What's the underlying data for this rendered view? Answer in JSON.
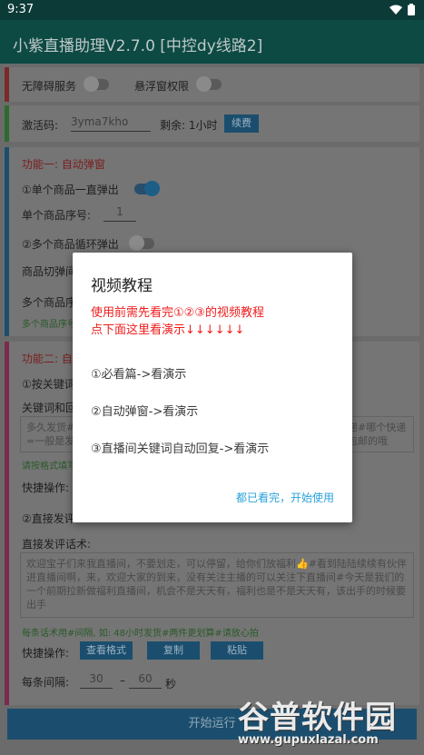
{
  "status": {
    "time": "9:37"
  },
  "app": {
    "title": "小紫直播助理V2.7.0 [中控dy线路2]"
  },
  "permissions": {
    "accessibility": "无障碍服务",
    "overlay": "悬浮窗权限"
  },
  "activation": {
    "label": "激活码:",
    "code": "3yma7kho",
    "remaining": "剩余: 1小时",
    "renew": "续费"
  },
  "func1": {
    "title": "功能一: 自动弹窗",
    "single_popup": "①单个商品一直弹出",
    "single_index_label": "单个商品序号:",
    "single_index_value": "1",
    "multi_loop": "②多个商品循环弹出",
    "switch_label": "商品切弹间",
    "multi_index_label": "多个商品序",
    "hint": "多个商品序号"
  },
  "func2": {
    "title": "功能二: 自",
    "keyword_reply": "①按关键词",
    "keyword_label": "关键词和回",
    "keyword_text": "多久发货#\n=一般是发",
    "keyword_text_right": "递#哪个快递\n包邮的哦",
    "format_hint": "请按格式填写",
    "quick_ops": "快捷操作:",
    "direct_comment": "②直接发评",
    "direct_label": "直接发评话术:",
    "direct_text": "欢迎宝子们来我直播间，不要划走，可以停留，给你们放福利👍#看到陆陆续续有伙伴进直播间啊，来，欢迎大家的到来，没有关注主播的可以关注下直播间#今天是我们的一个前期拉新做福利直播间，机会不是天天有，福利也是不是天天有，该出手的时候要出手",
    "per_hint": "每条话术用#间隔, 如: 48小时发货#两件更划算#请放心拍",
    "quick_ops2": "快捷操作:",
    "btn_format": "查看格式",
    "btn_copy": "复制",
    "btn_paste": "粘贴",
    "interval_label": "每条间隔:",
    "interval_min": "30",
    "interval_dash": "–",
    "interval_max": "60",
    "interval_unit": "秒"
  },
  "start_button": "开始运行",
  "dialog": {
    "title": "视频教程",
    "warning_line1": "使用前需先看完①②③的视频教程",
    "warning_line2": "点下面这里看演示↓↓↓↓↓↓",
    "item1": "①必看篇->看演示",
    "item2": "②自动弹窗->看演示",
    "item3": "③直播间关键词自动回复->看演示",
    "confirm": "都已看完，开始使用"
  },
  "watermark": {
    "name": "谷普软件园",
    "url": "www.gupuxlazal.com"
  },
  "colors": {
    "appbar": "#0d4a44",
    "accent": "#2aa2db",
    "warning": "#f01b1b",
    "button": "#1b4e6e"
  }
}
